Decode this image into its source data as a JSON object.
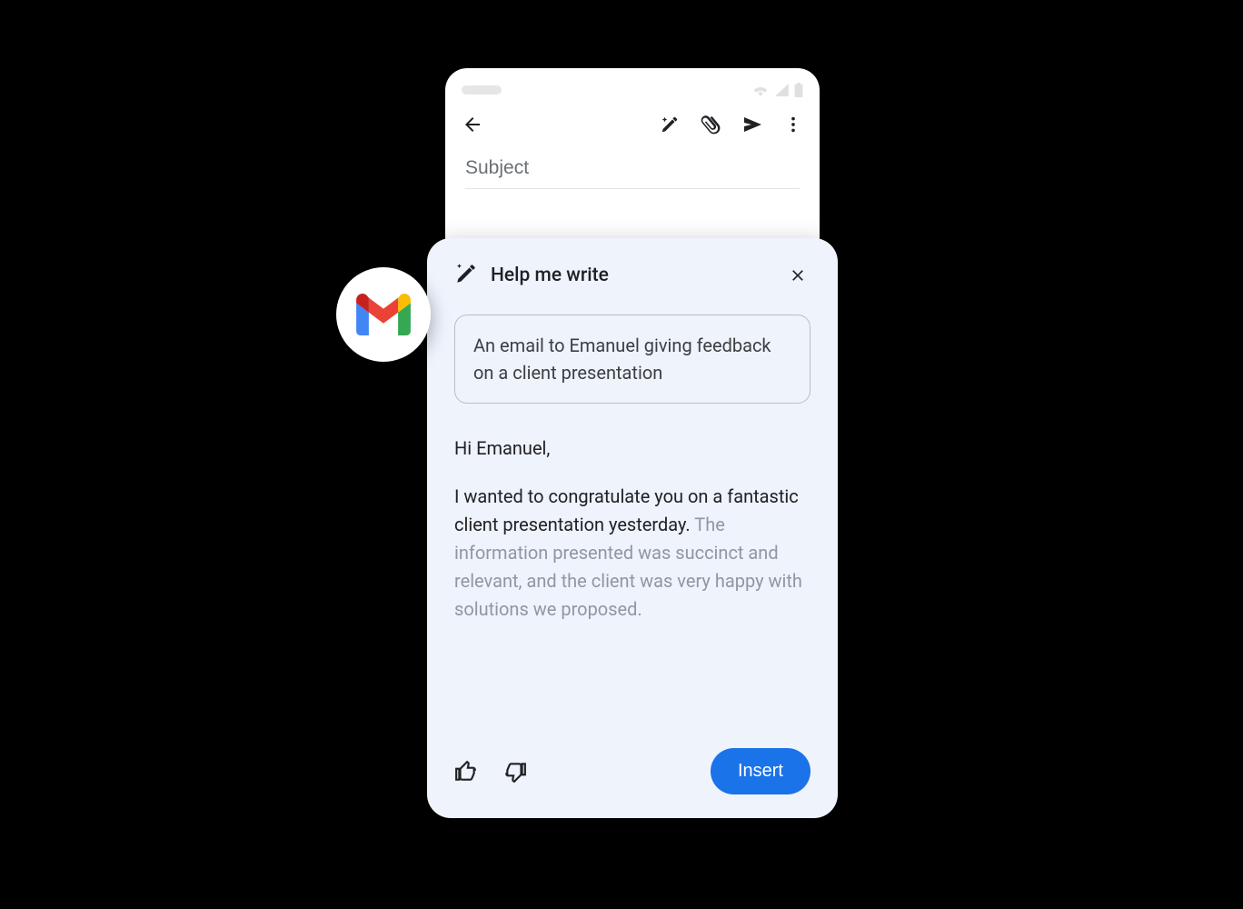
{
  "compose": {
    "subject_placeholder": "Subject"
  },
  "hmw": {
    "title": "Help me write",
    "prompt": "An email to Emanuel giving feedback on a client presentation",
    "draft_greeting": "Hi Emanuel,",
    "draft_body_strong": "I wanted to congratulate you on a fantastic client presentation yesterday. ",
    "draft_body_fade": "The information presented was succinct and relevant, and the client was very happy with solutions we proposed.",
    "insert_label": "Insert"
  }
}
